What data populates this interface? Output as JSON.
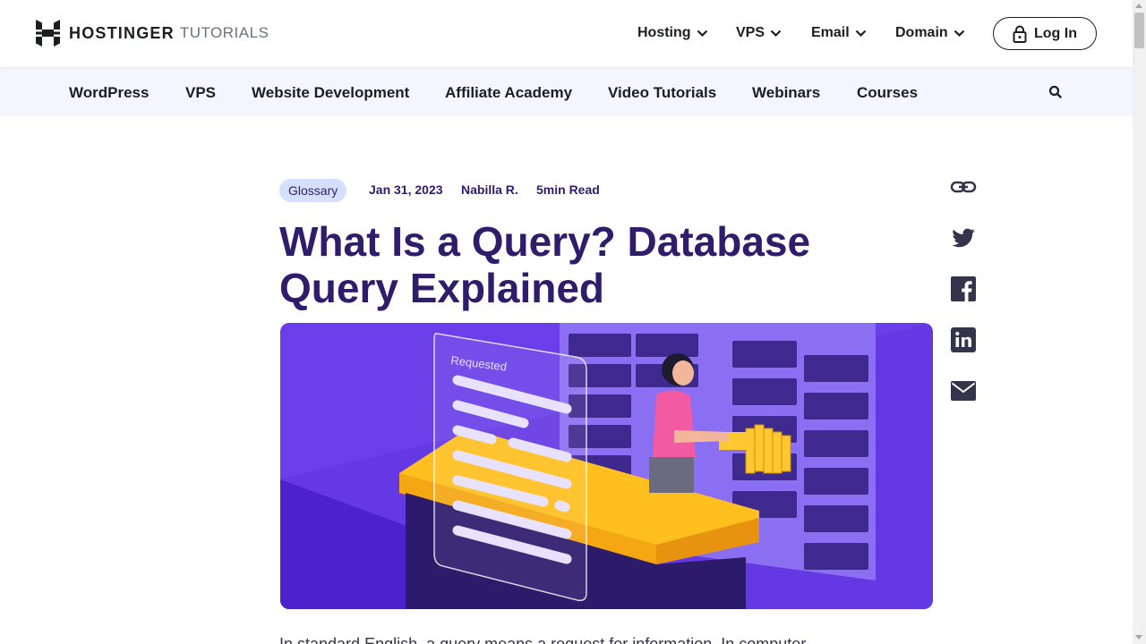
{
  "header": {
    "brand": "HOSTINGER",
    "brand_sub": "TUTORIALS",
    "nav": [
      {
        "label": "Hosting"
      },
      {
        "label": "VPS"
      },
      {
        "label": "Email"
      },
      {
        "label": "Domain"
      }
    ],
    "login_label": "Log In"
  },
  "subnav": {
    "items": [
      {
        "label": "WordPress"
      },
      {
        "label": "VPS"
      },
      {
        "label": "Website Development"
      },
      {
        "label": "Affiliate Academy"
      },
      {
        "label": "Video Tutorials"
      },
      {
        "label": "Webinars"
      },
      {
        "label": "Courses"
      }
    ],
    "search_icon": "search-icon"
  },
  "article": {
    "category": "Glossary",
    "date": "Jan 31, 2023",
    "author": "Nabilla R.",
    "read_time": "5min Read",
    "title": "What Is a Query? Database Query Explained",
    "hero_label": "Requested",
    "intro_partial": "In standard English, a query means a request for information. In computer"
  },
  "share": {
    "icons": [
      "link-icon",
      "twitter-icon",
      "facebook-icon",
      "linkedin-icon",
      "email-icon"
    ]
  },
  "colors": {
    "accent": "#673de6",
    "title": "#2f1c6a",
    "subnav_bg": "#f4f5ff",
    "chip_bg": "#d5dfff"
  }
}
